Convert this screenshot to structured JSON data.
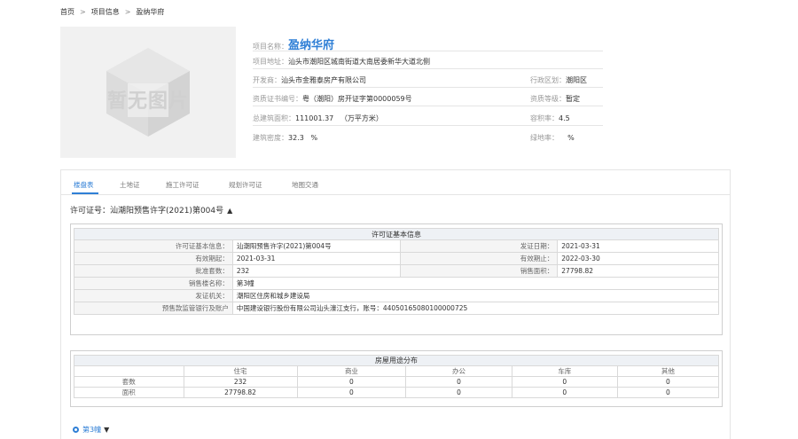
{
  "breadcrumb": {
    "items": [
      "首页",
      "项目信息",
      "盈纳华府"
    ],
    "separator": ">"
  },
  "thumbnail": {
    "placeholder_text": "暂无图片"
  },
  "project": {
    "name_label": "项目名称：",
    "name": "盈纳华府",
    "address_label": "项目地址：",
    "address": "汕头市潮阳区城南街道大南居委新华大道北侧",
    "developer_label": "开发商：",
    "developer": "汕头市金雅泰房产有限公司",
    "district_label": "行政区划：",
    "district": "潮阳区",
    "cert_label": "资质证书编号：",
    "cert": "粤（潮阳）房开证字第0000059号",
    "grade_label": "资质等级：",
    "grade": "暂定",
    "area_label": "总建筑面积：",
    "area": "111001.37",
    "area_unit": "（万平方米）",
    "far_label": "容积率：",
    "far": "4.5",
    "density_label": "建筑密度：",
    "density": "32.3",
    "density_unit": "%",
    "green_label": "绿地率：",
    "green_unit": "%"
  },
  "tabs": [
    {
      "label": "楼盘表",
      "active": true
    },
    {
      "label": "土地证",
      "active": false
    },
    {
      "label": "施工许可证",
      "active": false
    },
    {
      "label": "规划许可证",
      "active": false
    },
    {
      "label": "地图交通",
      "active": false
    }
  ],
  "license": {
    "prefix": "许可证号：",
    "number": "汕潮阳预售许字(2021)第004号",
    "toggle": "▲"
  },
  "basic_info": {
    "caption": "许可证基本信息",
    "rows": [
      {
        "k1": "许可证基本信息：",
        "v1": "汕潮阳预售许字(2021)第004号",
        "k2": "发证日期：",
        "v2": "2021-03-31"
      },
      {
        "k1": "有效期起：",
        "v1": "2021-03-31",
        "k2": "有效期止：",
        "v2": "2022-03-30"
      },
      {
        "k1": "批准套数：",
        "v1": "232",
        "k2": "销售面积：",
        "v2": "27798.82"
      }
    ],
    "wide_rows": [
      {
        "k": "销售楼名称：",
        "v": "第3幢"
      },
      {
        "k": "发证机关：",
        "v": "潮阳区住房和城乡建设局"
      },
      {
        "k": "预售款监管银行及账户",
        "v": "中国建设银行股份有限公司汕头濠江支行，账号：44050165080100000725"
      }
    ]
  },
  "usage": {
    "caption": "房屋用途分布",
    "columns": [
      "住宅",
      "商业",
      "办公",
      "车库",
      "其他"
    ],
    "rows": [
      {
        "label": "套数",
        "values": [
          "232",
          "0",
          "0",
          "0",
          "0"
        ]
      },
      {
        "label": "面积",
        "values": [
          "27798.82",
          "0",
          "0",
          "0",
          "0"
        ]
      }
    ]
  },
  "building": {
    "label": "第3幢",
    "toggle": "▼"
  },
  "colors": {
    "accent": "#2f7fd6",
    "border": "#d9d9d9",
    "header_bg": "#eef1f5"
  },
  "icons": {
    "house": "house-icon",
    "radio": "radio-dot-icon"
  }
}
